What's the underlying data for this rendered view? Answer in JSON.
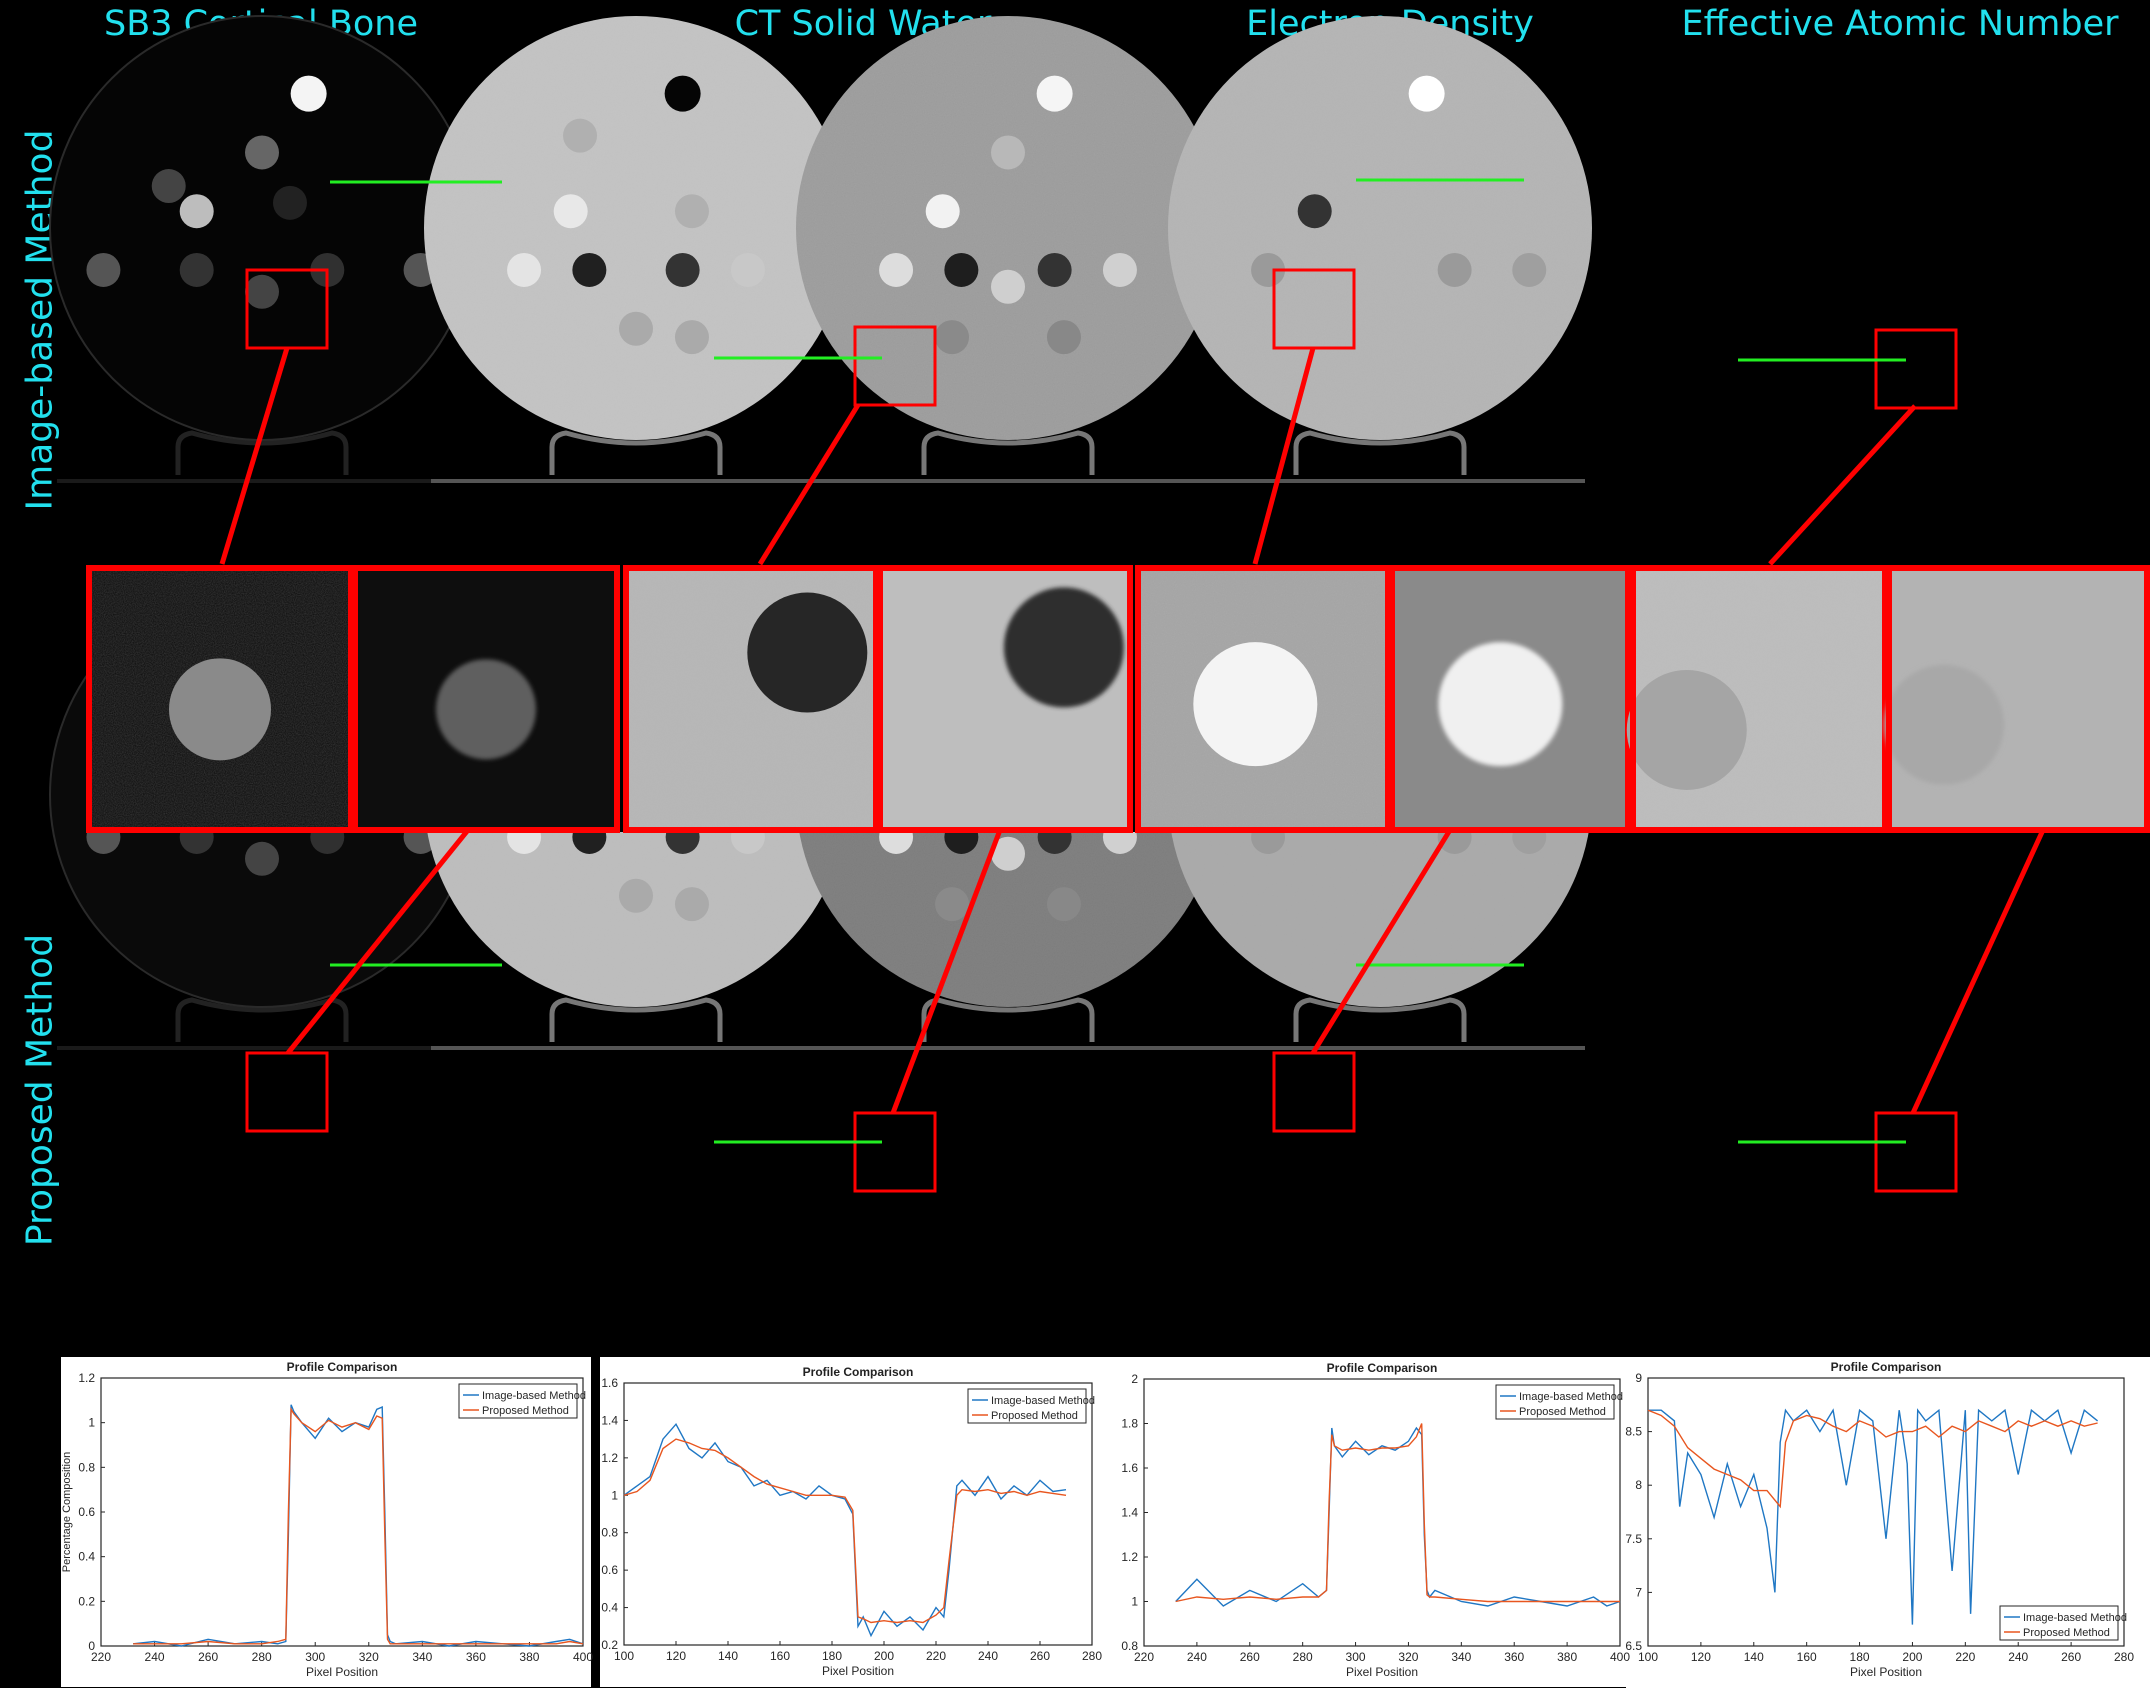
{
  "columns": [
    "SB3 Cortical Bone",
    "CT Solid Water",
    "Electron Density",
    "Effective Atomic Number"
  ],
  "rows": [
    "Image-based Method",
    "Proposed Method"
  ],
  "colors": {
    "title": "#22e0ee",
    "roi": "#ff0000",
    "profile_line": "#22ee22",
    "series1": "#1f77c4",
    "series2": "#e8561f"
  },
  "chart_data": [
    {
      "type": "line",
      "title": "Profile Comparison",
      "xlabel": "Pixel Position",
      "ylabel": "Percentage Composition",
      "xlim": [
        220,
        400
      ],
      "ylim": [
        0,
        1.2
      ],
      "xticks": [
        220,
        240,
        260,
        280,
        300,
        320,
        340,
        360,
        380,
        400
      ],
      "yticks": [
        0,
        0.2,
        0.4,
        0.6,
        0.8,
        1,
        1.2
      ],
      "legend": "top-right",
      "series": [
        {
          "name": "Image-based Method",
          "x": [
            232,
            240,
            250,
            260,
            270,
            280,
            286,
            289,
            290,
            291,
            292,
            295,
            300,
            305,
            310,
            315,
            320,
            323,
            325,
            326,
            327,
            328,
            330,
            340,
            350,
            360,
            370,
            380,
            390,
            395,
            400
          ],
          "y": [
            0.01,
            0.02,
            0.0,
            0.03,
            0.01,
            0.02,
            0.01,
            0.02,
            0.5,
            1.08,
            1.05,
            1.0,
            0.93,
            1.02,
            0.96,
            1.0,
            0.98,
            1.06,
            1.07,
            0.6,
            0.05,
            0.02,
            0.01,
            0.02,
            0.0,
            0.02,
            0.01,
            0.0,
            0.02,
            0.03,
            0.01
          ]
        },
        {
          "name": "Proposed Method",
          "x": [
            232,
            240,
            250,
            260,
            270,
            280,
            286,
            289,
            290,
            291,
            292,
            295,
            300,
            305,
            310,
            315,
            320,
            323,
            325,
            326,
            327,
            328,
            330,
            340,
            350,
            360,
            370,
            380,
            390,
            395,
            400
          ],
          "y": [
            0.01,
            0.01,
            0.01,
            0.02,
            0.01,
            0.01,
            0.02,
            0.03,
            0.6,
            1.06,
            1.04,
            1.0,
            0.96,
            1.01,
            0.98,
            1.0,
            0.97,
            1.03,
            1.02,
            0.5,
            0.03,
            0.01,
            0.01,
            0.01,
            0.01,
            0.01,
            0.01,
            0.01,
            0.01,
            0.02,
            0.01
          ]
        }
      ]
    },
    {
      "type": "line",
      "title": "Profile Comparison",
      "xlabel": "Pixel Position",
      "ylabel": "",
      "xlim": [
        100,
        280
      ],
      "ylim": [
        0.2,
        1.6
      ],
      "xticks": [
        100,
        120,
        140,
        160,
        180,
        200,
        220,
        240,
        260,
        280
      ],
      "yticks": [
        0.2,
        0.4,
        0.6,
        0.8,
        1,
        1.2,
        1.4,
        1.6
      ],
      "legend": "top-right",
      "series": [
        {
          "name": "Image-based Method",
          "x": [
            100,
            105,
            110,
            115,
            120,
            125,
            130,
            135,
            140,
            145,
            150,
            155,
            160,
            165,
            170,
            175,
            180,
            185,
            188,
            190,
            192,
            195,
            200,
            205,
            210,
            215,
            220,
            223,
            225,
            228,
            230,
            235,
            240,
            245,
            250,
            255,
            260,
            265,
            270
          ],
          "y": [
            1.0,
            1.05,
            1.1,
            1.3,
            1.38,
            1.25,
            1.2,
            1.28,
            1.18,
            1.15,
            1.05,
            1.08,
            1.0,
            1.02,
            0.98,
            1.05,
            1.0,
            0.98,
            0.9,
            0.3,
            0.35,
            0.25,
            0.38,
            0.3,
            0.35,
            0.28,
            0.4,
            0.35,
            0.6,
            1.05,
            1.08,
            1.0,
            1.1,
            0.98,
            1.05,
            1.0,
            1.08,
            1.02,
            1.03
          ]
        },
        {
          "name": "Proposed Method",
          "x": [
            100,
            105,
            110,
            115,
            120,
            125,
            130,
            135,
            140,
            145,
            150,
            155,
            160,
            165,
            170,
            175,
            180,
            185,
            188,
            190,
            192,
            195,
            200,
            205,
            210,
            215,
            220,
            223,
            225,
            228,
            230,
            235,
            240,
            245,
            250,
            255,
            260,
            265,
            270
          ],
          "y": [
            1.0,
            1.02,
            1.08,
            1.25,
            1.3,
            1.28,
            1.25,
            1.24,
            1.2,
            1.15,
            1.1,
            1.06,
            1.04,
            1.02,
            1.0,
            1.0,
            1.0,
            0.99,
            0.92,
            0.35,
            0.34,
            0.32,
            0.33,
            0.32,
            0.33,
            0.32,
            0.36,
            0.4,
            0.65,
            1.0,
            1.03,
            1.02,
            1.03,
            1.01,
            1.02,
            1.0,
            1.02,
            1.01,
            1.0
          ]
        }
      ]
    },
    {
      "type": "line",
      "title": "Profile Comparison",
      "xlabel": "Pixel Position",
      "ylabel": "",
      "xlim": [
        220,
        400
      ],
      "ylim": [
        0.8,
        2
      ],
      "xticks": [
        220,
        240,
        260,
        280,
        300,
        320,
        340,
        360,
        380,
        400
      ],
      "yticks": [
        0.8,
        1,
        1.2,
        1.4,
        1.6,
        1.8,
        2
      ],
      "legend": "top-right",
      "series": [
        {
          "name": "Image-based Method",
          "x": [
            232,
            240,
            250,
            260,
            270,
            280,
            286,
            289,
            290,
            291,
            292,
            295,
            300,
            305,
            310,
            315,
            320,
            323,
            325,
            326,
            327,
            328,
            330,
            340,
            350,
            360,
            370,
            380,
            390,
            395,
            400
          ],
          "y": [
            1.0,
            1.1,
            0.98,
            1.05,
            1.0,
            1.08,
            1.02,
            1.05,
            1.4,
            1.78,
            1.7,
            1.65,
            1.72,
            1.66,
            1.7,
            1.68,
            1.72,
            1.78,
            1.75,
            1.3,
            1.05,
            1.02,
            1.05,
            1.0,
            0.98,
            1.02,
            1.0,
            0.98,
            1.02,
            0.98,
            1.0
          ]
        },
        {
          "name": "Proposed Method",
          "x": [
            232,
            240,
            250,
            260,
            270,
            280,
            286,
            289,
            290,
            291,
            292,
            295,
            300,
            305,
            310,
            315,
            320,
            323,
            325,
            326,
            327,
            328,
            330,
            340,
            350,
            360,
            370,
            380,
            390,
            395,
            400
          ],
          "y": [
            1.0,
            1.02,
            1.01,
            1.02,
            1.01,
            1.02,
            1.02,
            1.05,
            1.45,
            1.75,
            1.7,
            1.68,
            1.69,
            1.68,
            1.69,
            1.69,
            1.7,
            1.74,
            1.8,
            1.35,
            1.03,
            1.02,
            1.02,
            1.01,
            1.0,
            1.0,
            1.0,
            1.0,
            1.0,
            1.0,
            1.0
          ]
        }
      ]
    },
    {
      "type": "line",
      "title": "Profile Comparison",
      "xlabel": "Pixel Position",
      "ylabel": "",
      "xlim": [
        100,
        280
      ],
      "ylim": [
        6.5,
        9
      ],
      "xticks": [
        100,
        120,
        140,
        160,
        180,
        200,
        220,
        240,
        260,
        280
      ],
      "yticks": [
        6.5,
        7,
        7.5,
        8,
        8.5,
        9
      ],
      "legend": "bottom-right",
      "series": [
        {
          "name": "Image-based Method",
          "x": [
            100,
            105,
            110,
            112,
            115,
            120,
            125,
            130,
            135,
            140,
            145,
            148,
            150,
            152,
            155,
            160,
            165,
            170,
            175,
            180,
            185,
            190,
            195,
            198,
            200,
            202,
            205,
            210,
            215,
            220,
            222,
            225,
            230,
            235,
            240,
            245,
            250,
            255,
            260,
            265,
            270
          ],
          "y": [
            8.7,
            8.7,
            8.6,
            7.8,
            8.3,
            8.1,
            7.7,
            8.2,
            7.8,
            8.1,
            7.6,
            7.0,
            8.4,
            8.7,
            8.6,
            8.7,
            8.5,
            8.7,
            8.0,
            8.7,
            8.6,
            7.5,
            8.7,
            8.2,
            6.7,
            8.7,
            8.6,
            8.7,
            7.2,
            8.7,
            6.8,
            8.7,
            8.6,
            8.7,
            8.1,
            8.7,
            8.6,
            8.7,
            8.3,
            8.7,
            8.6
          ]
        },
        {
          "name": "Proposed Method",
          "x": [
            100,
            105,
            110,
            115,
            120,
            125,
            130,
            135,
            140,
            145,
            150,
            152,
            155,
            160,
            165,
            170,
            175,
            180,
            185,
            190,
            195,
            200,
            205,
            210,
            215,
            220,
            225,
            230,
            235,
            240,
            245,
            250,
            255,
            260,
            265,
            270
          ],
          "y": [
            8.7,
            8.65,
            8.55,
            8.35,
            8.25,
            8.15,
            8.1,
            8.05,
            7.95,
            7.95,
            7.8,
            8.4,
            8.6,
            8.65,
            8.62,
            8.55,
            8.5,
            8.6,
            8.55,
            8.45,
            8.5,
            8.5,
            8.55,
            8.45,
            8.55,
            8.5,
            8.6,
            8.55,
            8.5,
            8.6,
            8.55,
            8.6,
            8.55,
            8.6,
            8.55,
            8.58
          ]
        }
      ]
    }
  ]
}
